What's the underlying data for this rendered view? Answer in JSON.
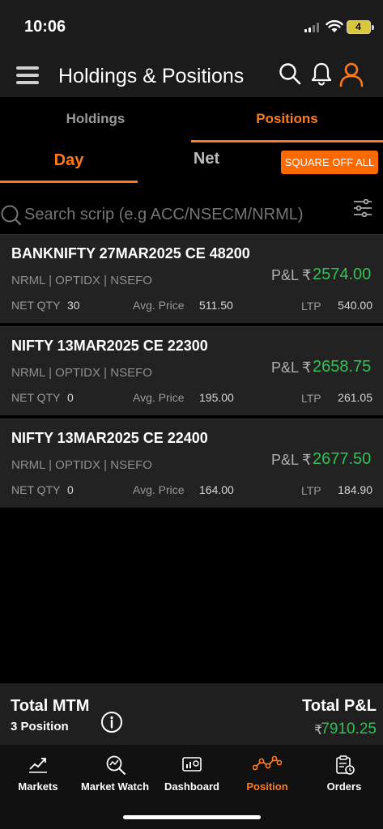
{
  "status_bar": {
    "time": "10:06",
    "battery": "4"
  },
  "header": {
    "title": "Holdings & Positions"
  },
  "top_tabs": {
    "holdings": "Holdings",
    "positions": "Positions"
  },
  "sub_tabs": {
    "day": "Day",
    "net": "Net",
    "square_off": "SQUARE OFF ALL"
  },
  "search": {
    "placeholder": "Search scrip (e.g ACC/NSECM/NRML)"
  },
  "labels": {
    "pl": "P&L",
    "rupee": "₹",
    "net_qty": "NET QTY",
    "avg_price": "Avg. Price",
    "ltp": "LTP"
  },
  "positions": [
    {
      "symbol": "BANKNIFTY 27MAR2025 CE 48200",
      "tags": "NRML | OPTIDX |  NSEFO",
      "pl": "2574.00",
      "net_qty": "30",
      "avg_price": "511.50",
      "ltp": "540.00"
    },
    {
      "symbol": "NIFTY 13MAR2025 CE 22300",
      "tags": "NRML | OPTIDX |  NSEFO",
      "pl": "2658.75",
      "net_qty": "0",
      "avg_price": "195.00",
      "ltp": "261.05"
    },
    {
      "symbol": "NIFTY 13MAR2025 CE 22400",
      "tags": "NRML | OPTIDX |  NSEFO",
      "pl": "2677.50",
      "net_qty": "0",
      "avg_price": "164.00",
      "ltp": "184.90"
    }
  ],
  "summary": {
    "mtm_title": "Total MTM",
    "position_count": "3 Position",
    "total_pl_title": "Total P&L",
    "rupee": "₹",
    "total_pl": "7910.25"
  },
  "nav": {
    "markets": "Markets",
    "market_watch": "Market Watch",
    "dashboard": "Dashboard",
    "position": "Position",
    "orders": "Orders"
  },
  "colors": {
    "accent": "#ff7a1a",
    "profit": "#33c155",
    "card_bg": "#222222"
  }
}
